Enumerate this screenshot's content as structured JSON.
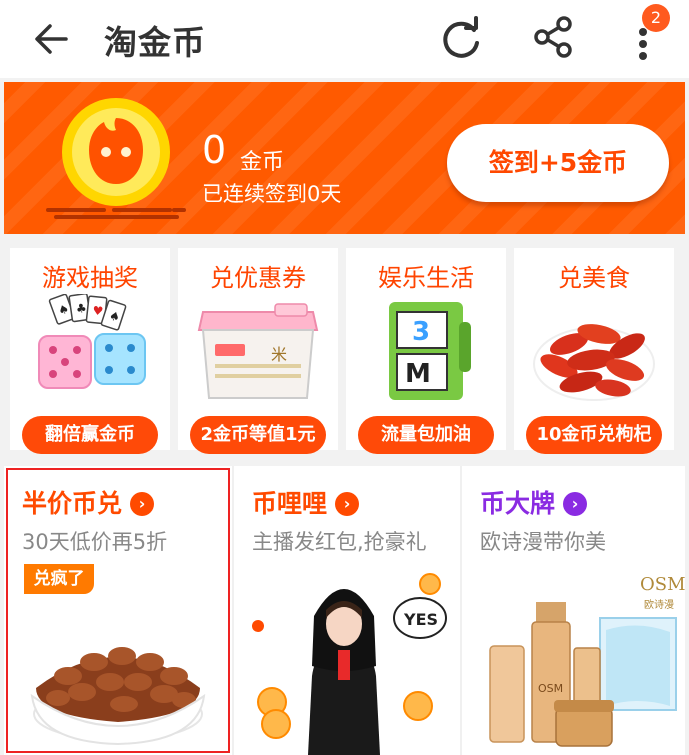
{
  "header": {
    "title": "淘金币",
    "notification_count": "2"
  },
  "banner": {
    "coin_amount": "0",
    "coin_unit": "金币",
    "streak_text": "已连续签到0天",
    "checkin_button": "签到+5金币"
  },
  "categories": [
    {
      "title": "游戏抽奖",
      "button": "翻倍赢金币",
      "icon": "dice-cards-icon"
    },
    {
      "title": "兑优惠券",
      "button": "2金币等值1元",
      "icon": "storage-box-icon"
    },
    {
      "title": "娱乐生活",
      "button": "流量包加油",
      "icon": "fuel-pump-icon"
    },
    {
      "title": "兑美食",
      "button": "10金币兑枸杞",
      "icon": "goji-berries-icon"
    }
  ],
  "promos": [
    {
      "title": "半价币兑",
      "subtitle": "30天低价再5折",
      "tag": "兑疯了",
      "title_color": "#ff4a00"
    },
    {
      "title": "币哩哩",
      "subtitle": "主播发红包,抢豪礼",
      "tag": "",
      "title_color": "#ff4a00"
    },
    {
      "title": "币大牌",
      "subtitle": "欧诗漫带你美",
      "tag": "",
      "title_color": "#8a2be2",
      "brand_text": "OSM",
      "brand_sub": "欧诗漫"
    }
  ],
  "colors": {
    "accent": "#ff5a00",
    "category_text": "#ff4400",
    "selected_outline": "#ee2222"
  }
}
